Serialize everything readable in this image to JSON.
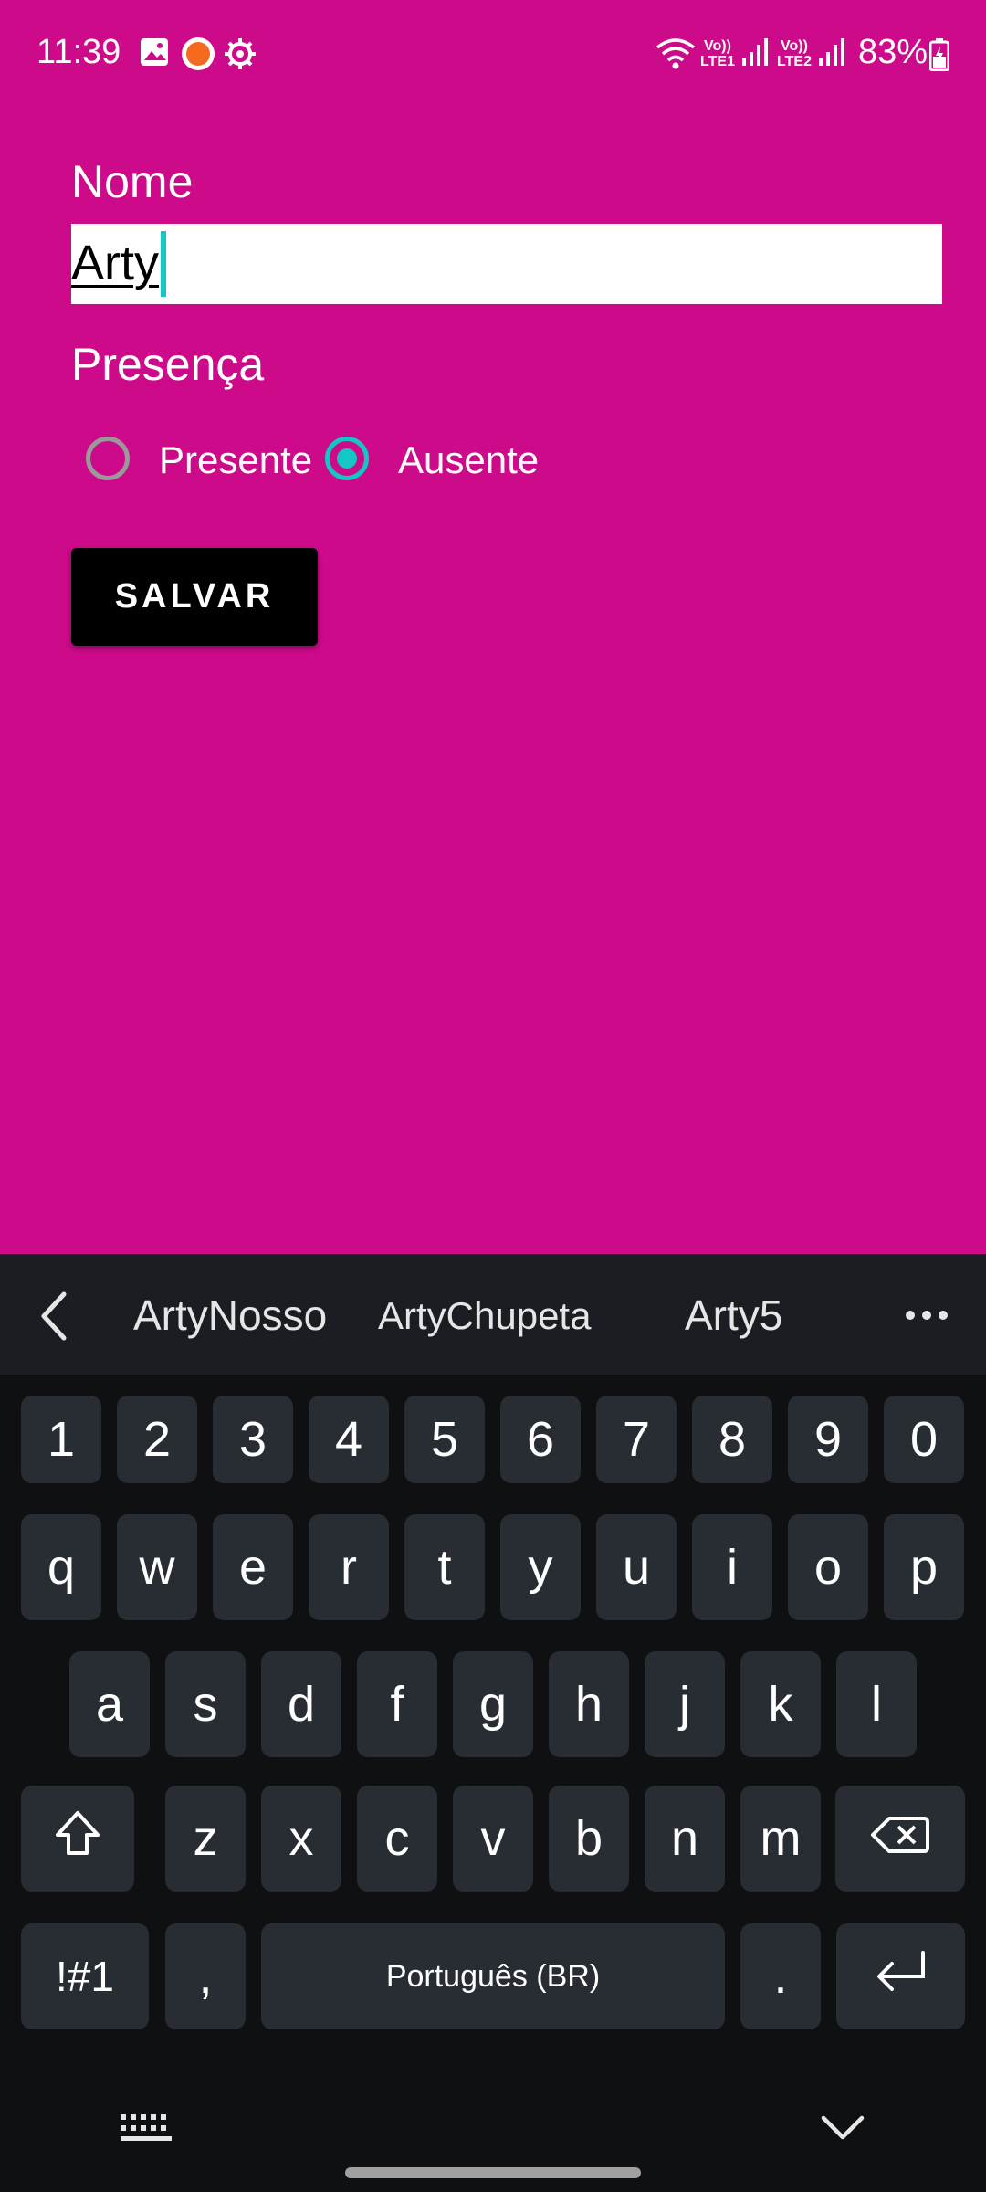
{
  "status_bar": {
    "time": "11:39",
    "battery": "83%",
    "sim1": "Vo)) LTE1",
    "sim2": "Vo)) LTE2",
    "icons": [
      "gallery-icon",
      "app-notification-icon",
      "settings-gear-icon",
      "wifi-icon",
      "signal-icon",
      "battery-charging-icon"
    ]
  },
  "form": {
    "name_label": "Nome",
    "name_value": "Arty",
    "presence_label": "Presença",
    "options": [
      {
        "label": "Presente",
        "selected": false
      },
      {
        "label": "Ausente",
        "selected": true
      }
    ],
    "save_label": "SALVAR"
  },
  "keyboard": {
    "suggestions": [
      "ArtyNosso",
      "ArtyChupeta",
      "Arty5"
    ],
    "row_numbers": [
      "1",
      "2",
      "3",
      "4",
      "5",
      "6",
      "7",
      "8",
      "9",
      "0"
    ],
    "row1": [
      "q",
      "w",
      "e",
      "r",
      "t",
      "y",
      "u",
      "i",
      "o",
      "p"
    ],
    "row2": [
      "a",
      "s",
      "d",
      "f",
      "g",
      "h",
      "j",
      "k",
      "l"
    ],
    "row3": [
      "z",
      "x",
      "c",
      "v",
      "b",
      "n",
      "m"
    ],
    "symbols_label": "!#1",
    "comma_label": ",",
    "space_label": "Português (BR)",
    "period_label": "."
  },
  "colors": {
    "app_background": "#CC0A8A",
    "accent": "#14C6C6",
    "button": "#000000",
    "keyboard_background": "#0E1012",
    "key": "#272D33"
  }
}
